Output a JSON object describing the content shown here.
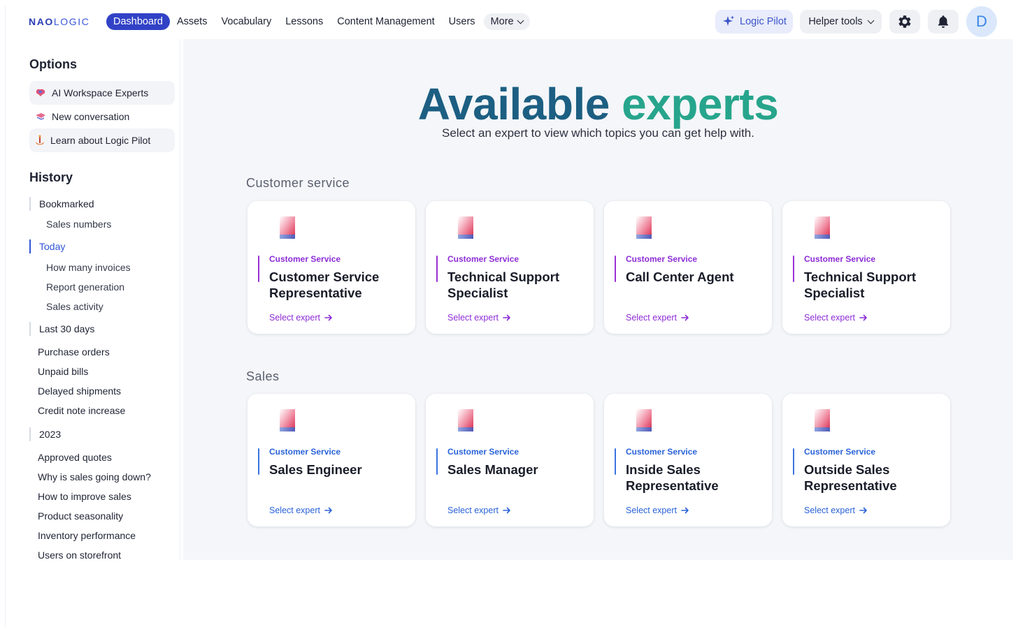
{
  "nav": {
    "logo_bold": "NAO",
    "logo_light": "LOGIC",
    "links": [
      "Dashboard",
      "Assets",
      "Vocabulary",
      "Lessons",
      "Content Management",
      "Users"
    ],
    "more_label": "More",
    "pilot_label": "Logic Pilot",
    "helper_label": "Helper tools",
    "avatar_letter": "D"
  },
  "sidebar": {
    "options_title": "Options",
    "options": [
      {
        "label": "AI Workspace Experts",
        "icon": "brain-icon"
      },
      {
        "label": "New conversation",
        "icon": "chat-icon"
      },
      {
        "label": "Learn about Logic Pilot",
        "icon": "anchor-icon"
      }
    ],
    "history_title": "History",
    "history": {
      "bookmarked": "Bookmarked",
      "bookmarked_items": [
        "Sales numbers"
      ],
      "today": "Today",
      "today_items": [
        "How many invoices",
        "Report generation",
        "Sales activity"
      ],
      "last30": "Last 30 days",
      "last30_items": [
        "Purchase orders",
        "Unpaid bills",
        "Delayed shipments",
        "Credit note increase"
      ],
      "year": "2023",
      "year_items": [
        "Approved quotes",
        "Why is sales going down?",
        "How to improve sales",
        "Product seasonality",
        "Inventory performance",
        "Users on storefront"
      ]
    }
  },
  "main": {
    "title_word1": "Available",
    "title_word2": "experts",
    "subtitle": "Select an expert to view which topics you can get help with.",
    "groups": [
      {
        "title": "Customer service",
        "accent": "#8d2cd6",
        "cards": [
          {
            "category": "Customer Service",
            "name": "Customer Service Representative",
            "action": "Select expert"
          },
          {
            "category": "Customer Service",
            "name": "Technical Support Specialist",
            "action": "Select expert"
          },
          {
            "category": "Customer Service",
            "name": "Call Center Agent",
            "action": "Select expert"
          },
          {
            "category": "Customer Service",
            "name": "Technical Support Specialist",
            "action": "Select expert"
          }
        ]
      },
      {
        "title": "Sales",
        "accent": "#2a63d8",
        "cards": [
          {
            "category": "Customer Service",
            "name": "Sales Engineer",
            "action": "Select expert"
          },
          {
            "category": "Customer Service",
            "name": "Sales Manager",
            "action": "Select expert"
          },
          {
            "category": "Customer Service",
            "name": "Inside Sales Representative",
            "action": "Select expert"
          },
          {
            "category": "Customer Service",
            "name": "Outside Sales Representative",
            "action": "Select expert"
          }
        ]
      }
    ]
  },
  "colors": {
    "primary": "#3142c6",
    "title_dark": "#1c5f82",
    "title_teal": "#27a58c",
    "purple": "#8d2cd6",
    "blue": "#2a63d8"
  }
}
